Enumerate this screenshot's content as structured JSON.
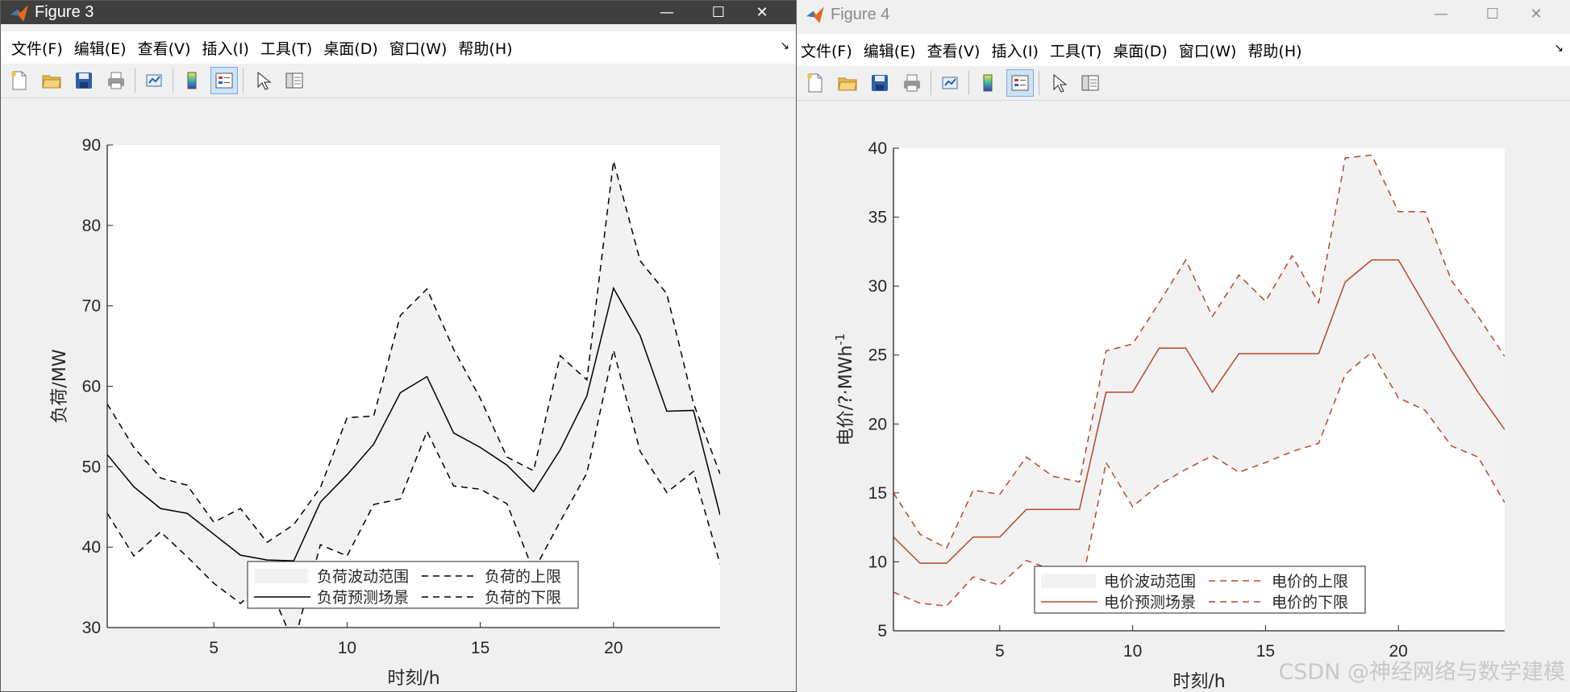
{
  "windows": [
    {
      "title": "Figure 3",
      "menus": [
        "文件(F)",
        "编辑(E)",
        "查看(V)",
        "插入(I)",
        "工具(T)",
        "桌面(D)",
        "窗口(W)",
        "帮助(H)"
      ],
      "window_controls": {
        "minimize": "—",
        "maximize": "☐",
        "close": "✕"
      }
    },
    {
      "title": "Figure 4",
      "menus": [
        "文件(F)",
        "编辑(E)",
        "查看(V)",
        "插入(I)",
        "工具(T)",
        "桌面(D)",
        "窗口(W)",
        "帮助(H)"
      ],
      "window_controls": {
        "minimize": "—",
        "maximize": "☐",
        "close": "✕"
      }
    }
  ],
  "toolbar_icons": [
    "new-figure-icon",
    "open-file-icon",
    "save-icon",
    "print-icon",
    "link-plot-icon",
    "colorbar-icon",
    "legend-icon",
    "pointer-icon",
    "property-inspector-icon"
  ],
  "chart_data": [
    {
      "type": "area",
      "xlabel": "时刻/h",
      "ylabel": "负荷/MW",
      "xlim": [
        1,
        24
      ],
      "ylim": [
        30,
        90
      ],
      "xticks": [
        5,
        10,
        15,
        20
      ],
      "yticks": [
        30,
        40,
        50,
        60,
        70,
        80,
        90
      ],
      "grid": false,
      "legend_position": "bottom-center",
      "line_color": "#000000",
      "band_color": "#f2f2f2",
      "x": [
        1,
        2,
        3,
        4,
        5,
        6,
        7,
        8,
        9,
        10,
        11,
        12,
        13,
        14,
        15,
        16,
        17,
        18,
        19,
        20,
        21,
        22,
        23,
        24
      ],
      "series": [
        {
          "name": "负荷预测场景",
          "style": "solid",
          "values": [
            51.5,
            47.5,
            44.8,
            44.2,
            41.6,
            39.0,
            38.4,
            38.3,
            45.6,
            49.0,
            52.8,
            59.2,
            61.2,
            54.2,
            52.4,
            50.2,
            46.9,
            52.1,
            58.8,
            72.2,
            66.3,
            56.9,
            57.0,
            44.0
          ]
        },
        {
          "name": "负荷的上限",
          "style": "dashed",
          "values": [
            57.8,
            52.4,
            48.6,
            47.7,
            43.1,
            44.8,
            40.6,
            42.8,
            47.4,
            56.1,
            56.3,
            68.8,
            72.1,
            64.6,
            58.5,
            51.2,
            49.5,
            63.8,
            60.8,
            88.0,
            75.6,
            71.5,
            57.9,
            49.1
          ]
        },
        {
          "name": "负荷的下限",
          "style": "dashed",
          "values": [
            44.2,
            38.9,
            41.9,
            38.8,
            35.5,
            33.0,
            35.8,
            28.0,
            40.3,
            38.9,
            45.3,
            46.0,
            54.4,
            47.6,
            47.2,
            45.4,
            37.0,
            43.2,
            49.2,
            64.5,
            51.9,
            46.8,
            49.4,
            37.9
          ]
        }
      ],
      "band_name": "负荷波动范围"
    },
    {
      "type": "area",
      "xlabel": "时刻/h",
      "ylabel": "电价/?·MWh",
      "ylabel_superscript": "-1",
      "xlim": [
        1,
        24
      ],
      "ylim": [
        5,
        40
      ],
      "xticks": [
        5,
        10,
        15,
        20
      ],
      "yticks": [
        5,
        10,
        15,
        20,
        25,
        30,
        35,
        40
      ],
      "grid": false,
      "legend_position": "bottom-center",
      "line_color": "#b5492b",
      "band_color": "#f2f2f2",
      "x": [
        1,
        2,
        3,
        4,
        5,
        6,
        7,
        8,
        9,
        10,
        11,
        12,
        13,
        14,
        15,
        16,
        17,
        18,
        19,
        20,
        21,
        22,
        23,
        24
      ],
      "series": [
        {
          "name": "电价预测场景",
          "style": "solid",
          "values": [
            11.8,
            9.9,
            9.9,
            11.8,
            11.8,
            13.8,
            13.8,
            13.8,
            22.3,
            22.3,
            25.5,
            25.5,
            22.3,
            25.1,
            25.1,
            25.1,
            25.1,
            30.3,
            31.9,
            31.9,
            28.6,
            25.3,
            22.3,
            19.6
          ]
        },
        {
          "name": "电价的上限",
          "style": "dashed",
          "values": [
            15.0,
            12.0,
            11.0,
            15.2,
            14.9,
            17.6,
            16.2,
            15.8,
            25.3,
            25.8,
            28.8,
            31.9,
            27.8,
            30.8,
            28.9,
            32.2,
            28.8,
            39.3,
            39.5,
            35.4,
            35.4,
            30.4,
            27.8,
            24.9
          ]
        },
        {
          "name": "电价的下限",
          "style": "dashed",
          "values": [
            7.8,
            7.0,
            6.8,
            8.9,
            8.3,
            10.1,
            9.4,
            7.5,
            17.2,
            14.0,
            15.6,
            16.7,
            17.7,
            16.5,
            17.2,
            18.0,
            18.6,
            23.6,
            25.2,
            21.9,
            21.0,
            18.4,
            17.6,
            14.3
          ]
        }
      ],
      "band_name": "电价波动范围"
    }
  ],
  "watermark": "CSDN @神经网络与数学建模"
}
